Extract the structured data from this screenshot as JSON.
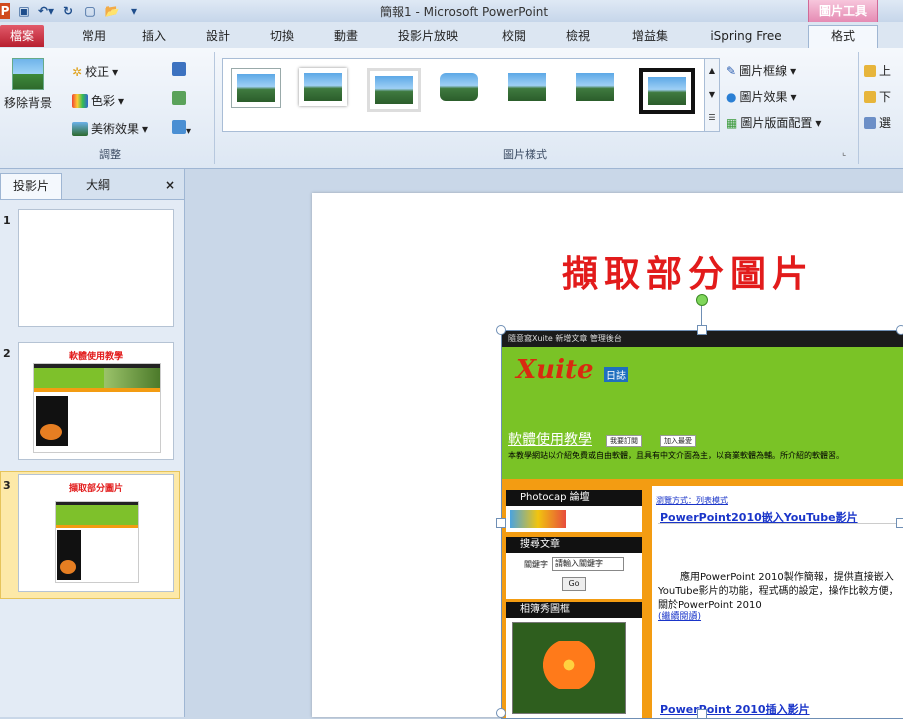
{
  "window": {
    "title": "簡報1 - Microsoft PowerPoint",
    "context_tab": "圖片工具"
  },
  "tabs": [
    {
      "label": "檔案"
    },
    {
      "label": "常用"
    },
    {
      "label": "插入"
    },
    {
      "label": "設計"
    },
    {
      "label": "切換"
    },
    {
      "label": "動畫"
    },
    {
      "label": "投影片放映"
    },
    {
      "label": "校閱"
    },
    {
      "label": "檢視"
    },
    {
      "label": "增益集"
    },
    {
      "label": "iSpring Free"
    },
    {
      "label": "格式"
    }
  ],
  "ribbon": {
    "adjust": {
      "remove_bg": "移除背景",
      "corrections": "校正",
      "color": "色彩",
      "artistic": "美術效果",
      "label": "調整"
    },
    "styles": {
      "label": "圖片樣式",
      "border": "圖片框線",
      "effects": "圖片效果",
      "layout": "圖片版面配置"
    },
    "arrange": {
      "forward": "上",
      "backward": "下",
      "select": "選"
    }
  },
  "left_pane": {
    "tab_slides": "投影片",
    "tab_outline": "大綱",
    "close": "×",
    "slides": [
      {
        "num": "1",
        "title": ""
      },
      {
        "num": "2",
        "title": "軟體使用教學"
      },
      {
        "num": "3",
        "title": "擷取部分圖片"
      }
    ]
  },
  "slide": {
    "title": "擷取部分圖片",
    "site": {
      "topbar": "隨意窩Xuite  新增文章  管理後台",
      "logo": "Xuite",
      "logo_sub": "日誌",
      "blog_title": "軟體使用教學",
      "btn_subscribe": "我要訂閱",
      "btn_fav": "加入最愛",
      "desc": "本教學網站以介紹免費或自由軟體，且具有中文介面為主，以商業軟體為輔。所介紹的軟體習。",
      "side1_title": "Photocap 論壇",
      "side2_title": "搜尋文章",
      "search_label": "關鍵字",
      "search_placeholder": "請輸入關鍵字",
      "search_btn": "Go",
      "side3_title": "相簿秀圖框",
      "browse": "瀏覽方式：列表模式",
      "post1_title": "PowerPoint2010嵌入YouTube影片",
      "post1_body": "應用PowerPoint 2010製作簡報，提供直接嵌入YouTube影片的功能，程式碼的設定，操作比較方便，關於PowerPoint 2010",
      "read_more": "(繼續閱讀)",
      "post2_title": "PowerPoint 2010插入影片"
    }
  }
}
